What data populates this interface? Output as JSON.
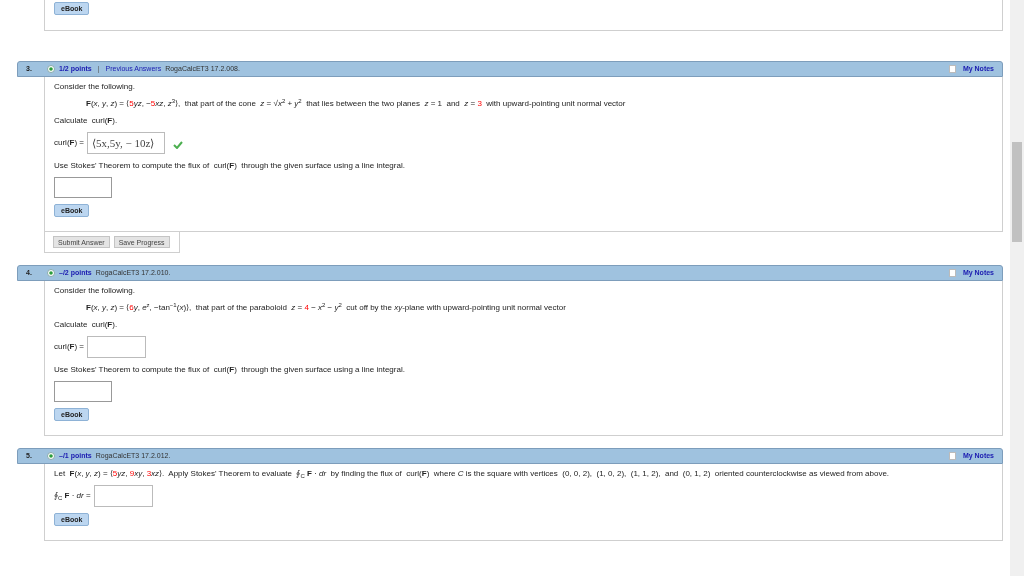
{
  "top_card": {
    "ebook": "eBook"
  },
  "problems": [
    {
      "number": "3.",
      "points": "1/2 points",
      "separator": "|",
      "previous_answers": "Previous Answers",
      "code": "RogaCalcET3 17.2.008.",
      "notes": "My Notes",
      "body": [
        {
          "kind": "text",
          "segments": [
            {
              "text": "Consider the following.",
              "highlight": false
            }
          ]
        },
        {
          "kind": "formula",
          "segments": [
            {
              "text": "**F**(*x*, *y*, *z*) = ⟨",
              "highlight": false
            },
            {
              "text": "5",
              "highlight": true
            },
            {
              "text": "*yz*, −",
              "highlight": false
            },
            {
              "text": "5",
              "highlight": true
            },
            {
              "text": "*xz*, *z*$^{3}$⟩,  that part of the cone  *z* = √*x*$^{2}$ + *y*$^{2}$  that lies between the two planes  *z* = 1  and  *z* = ",
              "highlight": false
            },
            {
              "text": "3",
              "highlight": true
            },
            {
              "text": "  with upward-pointing unit normal vector",
              "highlight": false
            }
          ]
        },
        {
          "kind": "text",
          "segments": [
            {
              "text": "Calculate  curl(**F**).",
              "highlight": false
            }
          ]
        },
        {
          "kind": "answer",
          "label": "curl(**F**) =",
          "value": "⟨5x,5y, − 10z⟩",
          "correct": true
        },
        {
          "kind": "text",
          "segments": [
            {
              "text": "Use Stokes' Theorem to compute the flux of  curl(**F**)  through the given surface using a line integral.",
              "highlight": false
            }
          ]
        },
        {
          "kind": "input"
        },
        {
          "kind": "ebook",
          "label": "eBook"
        }
      ],
      "actions": [
        "Submit Answer",
        "Save Progress"
      ]
    },
    {
      "number": "4.",
      "points": "–/2 points",
      "code": "RogaCalcET3 17.2.010.",
      "notes": "My Notes",
      "body": [
        {
          "kind": "text",
          "segments": [
            {
              "text": "Consider the following.",
              "highlight": false
            }
          ]
        },
        {
          "kind": "formula",
          "segments": [
            {
              "text": "**F**(*x*, *y*, *z*) = ⟨",
              "highlight": false
            },
            {
              "text": "6",
              "highlight": true
            },
            {
              "text": "*y*, *e*$^{z}$, −tan$^{−1}$(*x*)⟩,  that part of the paraboloid  *z* = ",
              "highlight": false
            },
            {
              "text": "4",
              "highlight": true
            },
            {
              "text": " − *x*$^{2}$ − *y*$^{2}$  cut off by the *xy*-plane with upward-pointing unit normal vector",
              "highlight": false
            }
          ]
        },
        {
          "kind": "text",
          "segments": [
            {
              "text": "Calculate  curl(**F**).",
              "highlight": false
            }
          ]
        },
        {
          "kind": "answer",
          "label": "curl(**F**) =",
          "correct": false
        },
        {
          "kind": "text",
          "segments": [
            {
              "text": "Use Stokes' Theorem to compute the flux of  curl(**F**)  through the given surface using a line integral.",
              "highlight": false
            }
          ]
        },
        {
          "kind": "input"
        },
        {
          "kind": "ebook",
          "label": "eBook"
        }
      ]
    },
    {
      "number": "5.",
      "points": "–/1 points",
      "code": "RogaCalcET3 17.2.012.",
      "notes": "My Notes",
      "body": [
        {
          "kind": "text",
          "segments": [
            {
              "text": "Let  **F**(*x*, *y*, *z*) = ⟨",
              "highlight": false
            },
            {
              "text": "5",
              "highlight": true
            },
            {
              "text": "*yz*, ",
              "highlight": false
            },
            {
              "text": "9",
              "highlight": true
            },
            {
              "text": "*xy*, ",
              "highlight": false
            },
            {
              "text": "3",
              "highlight": true
            },
            {
              "text": "*xz*⟩.  Apply Stokes' Theorem to evaluate  ∮$_{C}$ **F** · *dr*  by finding the flux of  curl(**F**)  where *C* is the square with vertices  (0, 0, 2),  (1, 0, 2),  (1, 1, 2),  and  (0, 1, 2)  oriented counterclockwise as viewed from above.",
              "highlight": false
            }
          ]
        },
        {
          "kind": "answer",
          "label": "∮$_{C}$ **F** · *dr* =",
          "correct": false
        },
        {
          "kind": "ebook",
          "label": "eBook"
        }
      ]
    }
  ]
}
